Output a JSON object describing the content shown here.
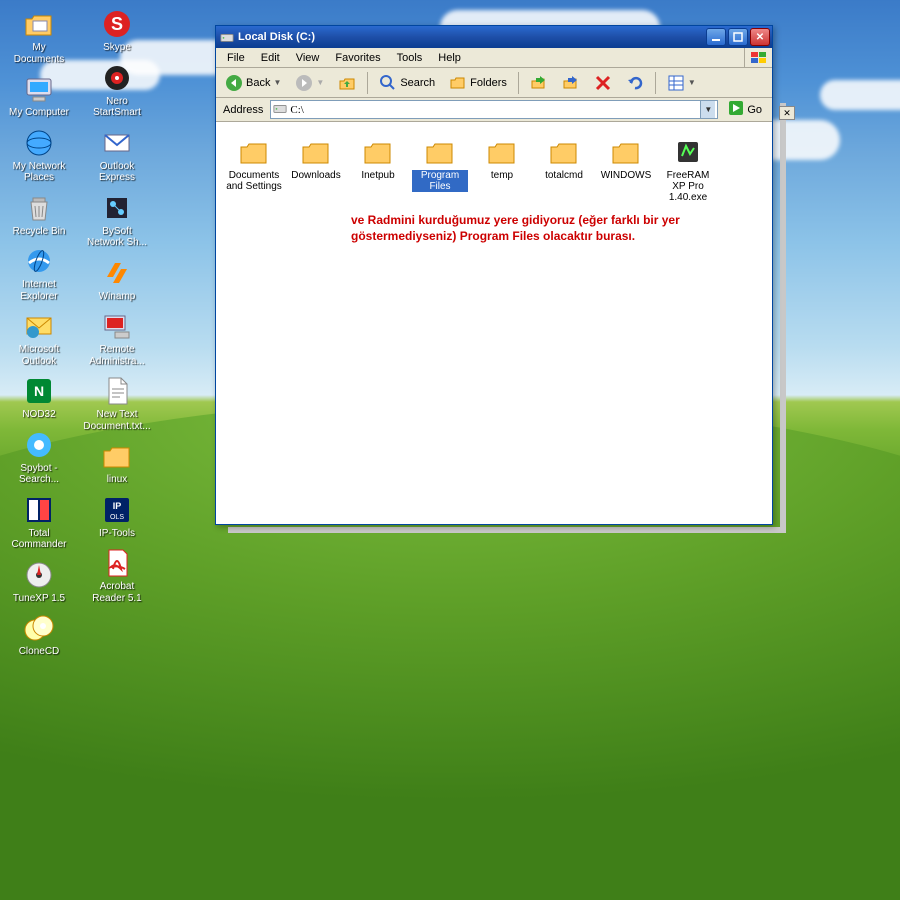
{
  "desktop": {
    "icons": [
      {
        "label": "My Documents",
        "glyph": "docs"
      },
      {
        "label": "My Computer",
        "glyph": "computer"
      },
      {
        "label": "My Network Places",
        "glyph": "network"
      },
      {
        "label": "Recycle Bin",
        "glyph": "recycle"
      },
      {
        "label": "Internet Explorer",
        "glyph": "ie"
      },
      {
        "label": "Microsoft Outlook",
        "glyph": "outlook"
      },
      {
        "label": "NOD32",
        "glyph": "nod32"
      },
      {
        "label": "Spybot - Search...",
        "glyph": "spybot"
      },
      {
        "label": "Total Commander",
        "glyph": "totalcmd"
      },
      {
        "label": "TuneXP 1.5",
        "glyph": "tune"
      },
      {
        "label": "CloneCD",
        "glyph": "clonecd"
      },
      {
        "label": "Skype",
        "glyph": "skype"
      },
      {
        "label": "Nero StartSmart",
        "glyph": "nero"
      },
      {
        "label": "Outlook Express",
        "glyph": "oe"
      },
      {
        "label": "BySoft Network Sh...",
        "glyph": "bysoft"
      },
      {
        "label": "Winamp",
        "glyph": "winamp"
      },
      {
        "label": "Remote Administra...",
        "glyph": "radmin"
      },
      {
        "label": "New Text Document.txt...",
        "glyph": "txt"
      },
      {
        "label": "linux",
        "glyph": "folder"
      },
      {
        "label": "IP-Tools",
        "glyph": "iptools"
      },
      {
        "label": "Acrobat Reader 5.1",
        "glyph": "acrobat"
      }
    ]
  },
  "window": {
    "title": "Local Disk (C:)",
    "menu": [
      "File",
      "Edit",
      "View",
      "Favorites",
      "Tools",
      "Help"
    ],
    "toolbar": {
      "back": "Back",
      "search": "Search",
      "folders": "Folders"
    },
    "address_label": "Address",
    "address_value": "C:\\",
    "go_label": "Go",
    "items": [
      {
        "label": "Documents and Settings",
        "type": "folder"
      },
      {
        "label": "Downloads",
        "type": "folder"
      },
      {
        "label": "Inetpub",
        "type": "folder"
      },
      {
        "label": "Program Files",
        "type": "folder",
        "selected": true
      },
      {
        "label": "temp",
        "type": "folder"
      },
      {
        "label": "totalcmd",
        "type": "folder"
      },
      {
        "label": "WINDOWS",
        "type": "folder"
      },
      {
        "label": "FreeRAM XP Pro 1.40.exe",
        "type": "exe"
      }
    ],
    "annotation": "ve Radmini kurduğumuz yere gidiyoruz (eğer farklı bir yer göstermediyseniz) Program Files olacaktır burası."
  }
}
